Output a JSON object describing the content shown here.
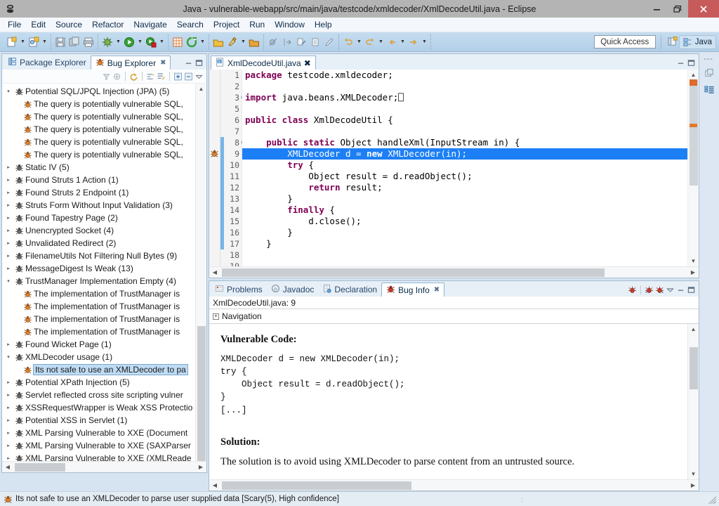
{
  "window": {
    "title": "Java - vulnerable-webapp/src/main/java/testcode/xmldecoder/XmlDecodeUtil.java - Eclipse",
    "minimize_label": "–",
    "restore_label": "❐",
    "close_label": "✕"
  },
  "menubar": {
    "items": [
      "File",
      "Edit",
      "Source",
      "Refactor",
      "Navigate",
      "Search",
      "Project",
      "Run",
      "Window",
      "Help"
    ]
  },
  "toolbar": {
    "quick_access_label": "Quick Access",
    "perspective_label": "Java",
    "groups": [
      {
        "buttons": [
          "new-wizard-icon",
          "new-java-class-icon",
          "save-icon",
          "save-all-icon",
          "print-icon"
        ]
      },
      {
        "buttons": [
          "debug-icon",
          "run-icon",
          "external-tools-icon"
        ]
      },
      {
        "buttons": [
          "new-java-project-icon",
          "coverage-icon"
        ]
      },
      {
        "buttons": [
          "open-type-icon",
          "search-icon",
          "open-task-icon"
        ]
      },
      {
        "buttons": [
          "skip-breakpoints-icon",
          "next-annotation-icon",
          "previous-annotation-icon",
          "last-edit-icon",
          "back-icon",
          "forward-icon"
        ]
      }
    ]
  },
  "bug_explorer": {
    "tabs": [
      {
        "label": "Package Explorer",
        "icon": "package-explorer-icon",
        "active": false,
        "closable": false
      },
      {
        "label": "Bug Explorer",
        "icon": "bug-icon",
        "active": true,
        "closable": true
      }
    ],
    "view_buttons": [
      "minimize-icon",
      "maximize-icon"
    ],
    "toolbar_buttons": [
      "filter-icon",
      "link-with-editor-icon",
      "refresh-bugs-icon",
      "sort-icon",
      "configure-icon",
      "expand-all-icon",
      "collapse-all-icon",
      "view-menu-icon"
    ],
    "tree": [
      {
        "label": "Potential SQL/JPQL Injection (JPA) (5)",
        "level": 0,
        "state": "expanded",
        "selected": false
      },
      {
        "label": "The query is potentially vulnerable SQL,",
        "level": 1,
        "state": "leaf",
        "selected": false
      },
      {
        "label": "The query is potentially vulnerable SQL,",
        "level": 1,
        "state": "leaf",
        "selected": false
      },
      {
        "label": "The query is potentially vulnerable SQL,",
        "level": 1,
        "state": "leaf",
        "selected": false
      },
      {
        "label": "The query is potentially vulnerable SQL,",
        "level": 1,
        "state": "leaf",
        "selected": false
      },
      {
        "label": "The query is potentially vulnerable SQL,",
        "level": 1,
        "state": "leaf",
        "selected": false
      },
      {
        "label": "Static IV (5)",
        "level": 0,
        "state": "collapsed",
        "selected": false
      },
      {
        "label": "Found Struts 1 Action (1)",
        "level": 0,
        "state": "collapsed",
        "selected": false
      },
      {
        "label": "Found Struts 2 Endpoint (1)",
        "level": 0,
        "state": "collapsed",
        "selected": false
      },
      {
        "label": "Struts Form Without Input Validation (3)",
        "level": 0,
        "state": "collapsed",
        "selected": false
      },
      {
        "label": "Found Tapestry Page (2)",
        "level": 0,
        "state": "collapsed",
        "selected": false
      },
      {
        "label": "Unencrypted Socket (4)",
        "level": 0,
        "state": "collapsed",
        "selected": false
      },
      {
        "label": "Unvalidated Redirect (2)",
        "level": 0,
        "state": "collapsed",
        "selected": false
      },
      {
        "label": "FilenameUtils Not Filtering Null Bytes (9)",
        "level": 0,
        "state": "collapsed",
        "selected": false
      },
      {
        "label": "MessageDigest Is Weak (13)",
        "level": 0,
        "state": "collapsed",
        "selected": false
      },
      {
        "label": "TrustManager Implementation Empty (4)",
        "level": 0,
        "state": "expanded",
        "selected": false
      },
      {
        "label": "The implementation of TrustManager is",
        "level": 1,
        "state": "leaf",
        "selected": false
      },
      {
        "label": "The implementation of TrustManager is",
        "level": 1,
        "state": "leaf",
        "selected": false
      },
      {
        "label": "The implementation of TrustManager is",
        "level": 1,
        "state": "leaf",
        "selected": false
      },
      {
        "label": "The implementation of TrustManager is",
        "level": 1,
        "state": "leaf",
        "selected": false
      },
      {
        "label": "Found Wicket Page (1)",
        "level": 0,
        "state": "collapsed",
        "selected": false
      },
      {
        "label": "XMLDecoder usage (1)",
        "level": 0,
        "state": "expanded",
        "selected": false
      },
      {
        "label": "Its not safe to use an XMLDecoder to pa",
        "level": 1,
        "state": "leaf",
        "selected": true
      },
      {
        "label": "Potential XPath Injection (5)",
        "level": 0,
        "state": "collapsed",
        "selected": false
      },
      {
        "label": "Servlet reflected cross site scripting vulner",
        "level": 0,
        "state": "collapsed",
        "selected": false
      },
      {
        "label": "XSSRequestWrapper is Weak XSS Protectio",
        "level": 0,
        "state": "collapsed",
        "selected": false
      },
      {
        "label": "Potential XSS in Servlet (1)",
        "level": 0,
        "state": "collapsed",
        "selected": false
      },
      {
        "label": "XML Parsing Vulnerable to XXE (Document",
        "level": 0,
        "state": "collapsed",
        "selected": false
      },
      {
        "label": "XML Parsing Vulnerable to XXE (SAXParser",
        "level": 0,
        "state": "collapsed",
        "selected": false
      },
      {
        "label": "XML Parsing Vulnerable to XXE (XMLReade",
        "level": 0,
        "state": "collapsed",
        "selected": false
      }
    ]
  },
  "editor": {
    "tab": {
      "label": "XmlDecodeUtil.java",
      "icon": "java-file-icon",
      "close_label": "✖"
    },
    "view_buttons": [
      "minimize-icon",
      "maximize-icon"
    ],
    "selected_line": 9,
    "marker_line": 9,
    "marker_icon": "bug-icon",
    "changed_from_line": 8,
    "changed_to_line": 17,
    "lines": [
      {
        "n": 1,
        "fold": "",
        "tokens": [
          {
            "t": "package",
            "c": "kw"
          },
          {
            "t": " testcode.xmldecoder;",
            "c": "plain"
          }
        ]
      },
      {
        "n": 2,
        "fold": "",
        "tokens": []
      },
      {
        "n": 3,
        "fold": "+",
        "tokens": [
          {
            "t": "import",
            "c": "kw"
          },
          {
            "t": " java.beans.XMLDecoder;",
            "c": "plain"
          },
          {
            "t": "⎕",
            "c": "box"
          }
        ]
      },
      {
        "n": 5,
        "fold": "",
        "tokens": []
      },
      {
        "n": 6,
        "fold": "",
        "tokens": [
          {
            "t": "public class",
            "c": "kw"
          },
          {
            "t": " XmlDecodeUtil {",
            "c": "plain"
          }
        ]
      },
      {
        "n": 7,
        "fold": "",
        "tokens": []
      },
      {
        "n": 8,
        "fold": "-",
        "tokens": [
          {
            "t": "    ",
            "c": "plain"
          },
          {
            "t": "public static",
            "c": "kw"
          },
          {
            "t": " Object handleXml(InputStream in) {",
            "c": "plain"
          }
        ]
      },
      {
        "n": 9,
        "fold": "",
        "tokens": [
          {
            "t": "        XMLDecoder d = ",
            "c": "plain"
          },
          {
            "t": "new",
            "c": "kw"
          },
          {
            "t": " XMLDecoder(in);",
            "c": "plain"
          }
        ]
      },
      {
        "n": 10,
        "fold": "",
        "tokens": [
          {
            "t": "        ",
            "c": "plain"
          },
          {
            "t": "try",
            "c": "kw"
          },
          {
            "t": " {",
            "c": "plain"
          }
        ]
      },
      {
        "n": 11,
        "fold": "",
        "tokens": [
          {
            "t": "            Object result = d.readObject();",
            "c": "plain"
          }
        ]
      },
      {
        "n": 12,
        "fold": "",
        "tokens": [
          {
            "t": "            ",
            "c": "plain"
          },
          {
            "t": "return",
            "c": "kw"
          },
          {
            "t": " result;",
            "c": "plain"
          }
        ]
      },
      {
        "n": 13,
        "fold": "",
        "tokens": [
          {
            "t": "        }",
            "c": "plain"
          }
        ]
      },
      {
        "n": 14,
        "fold": "",
        "tokens": [
          {
            "t": "        ",
            "c": "plain"
          },
          {
            "t": "finally",
            "c": "kw"
          },
          {
            "t": " {",
            "c": "plain"
          }
        ]
      },
      {
        "n": 15,
        "fold": "",
        "tokens": [
          {
            "t": "            d.close();",
            "c": "plain"
          }
        ]
      },
      {
        "n": 16,
        "fold": "",
        "tokens": [
          {
            "t": "        }",
            "c": "plain"
          }
        ]
      },
      {
        "n": 17,
        "fold": "",
        "tokens": [
          {
            "t": "    }",
            "c": "plain"
          }
        ]
      },
      {
        "n": 18,
        "fold": "",
        "tokens": []
      },
      {
        "n": 19,
        "fold": "",
        "tokens": []
      }
    ]
  },
  "bug_info": {
    "tabs": [
      {
        "label": "Problems",
        "icon": "problems-icon",
        "active": false,
        "closable": false
      },
      {
        "label": "Javadoc",
        "icon": "javadoc-icon",
        "active": false,
        "closable": false
      },
      {
        "label": "Declaration",
        "icon": "declaration-icon",
        "active": false,
        "closable": false
      },
      {
        "label": "Bug Info",
        "icon": "bug-icon",
        "active": true,
        "closable": true
      }
    ],
    "toolbar_buttons": [
      "bug-nav-icon",
      "bug-prev-icon",
      "bug-next-icon",
      "view-menu-icon",
      "minimize-icon",
      "maximize-icon"
    ],
    "location": "XmlDecodeUtil.java: 9",
    "navigation_label": "Navigation",
    "navigation_expander": "+",
    "vulnerable_code_heading": "Vulnerable Code:",
    "vulnerable_code": "XMLDecoder d = new XMLDecoder(in);\ntry {\n    Object result = d.readObject();\n}\n[...]",
    "solution_heading": "Solution:",
    "solution_text": "The solution is to avoid using XMLDecoder to parse content from an untrusted source."
  },
  "fastview": {
    "buttons": [
      "restore-icon",
      "package-explorer-icon",
      "outline-icon"
    ]
  },
  "statusbar": {
    "icon": "bug-icon",
    "message": "Its not safe to use an XMLDecoder to parse user supplied data [Scary(5), High confidence]"
  },
  "colors": {
    "title_bg": "#b4b4b4",
    "close_btn": "#c75b5b",
    "toolbar_gradient_top": "#c5dcef",
    "workbench_bg": "#d6e3f0",
    "selection_blue": "#1d7ff5",
    "tree_selection": "#bfdcf4",
    "keyword_purple": "#7f0055",
    "bug_orange": "#e0832b",
    "bug_red": "#cc2222"
  }
}
